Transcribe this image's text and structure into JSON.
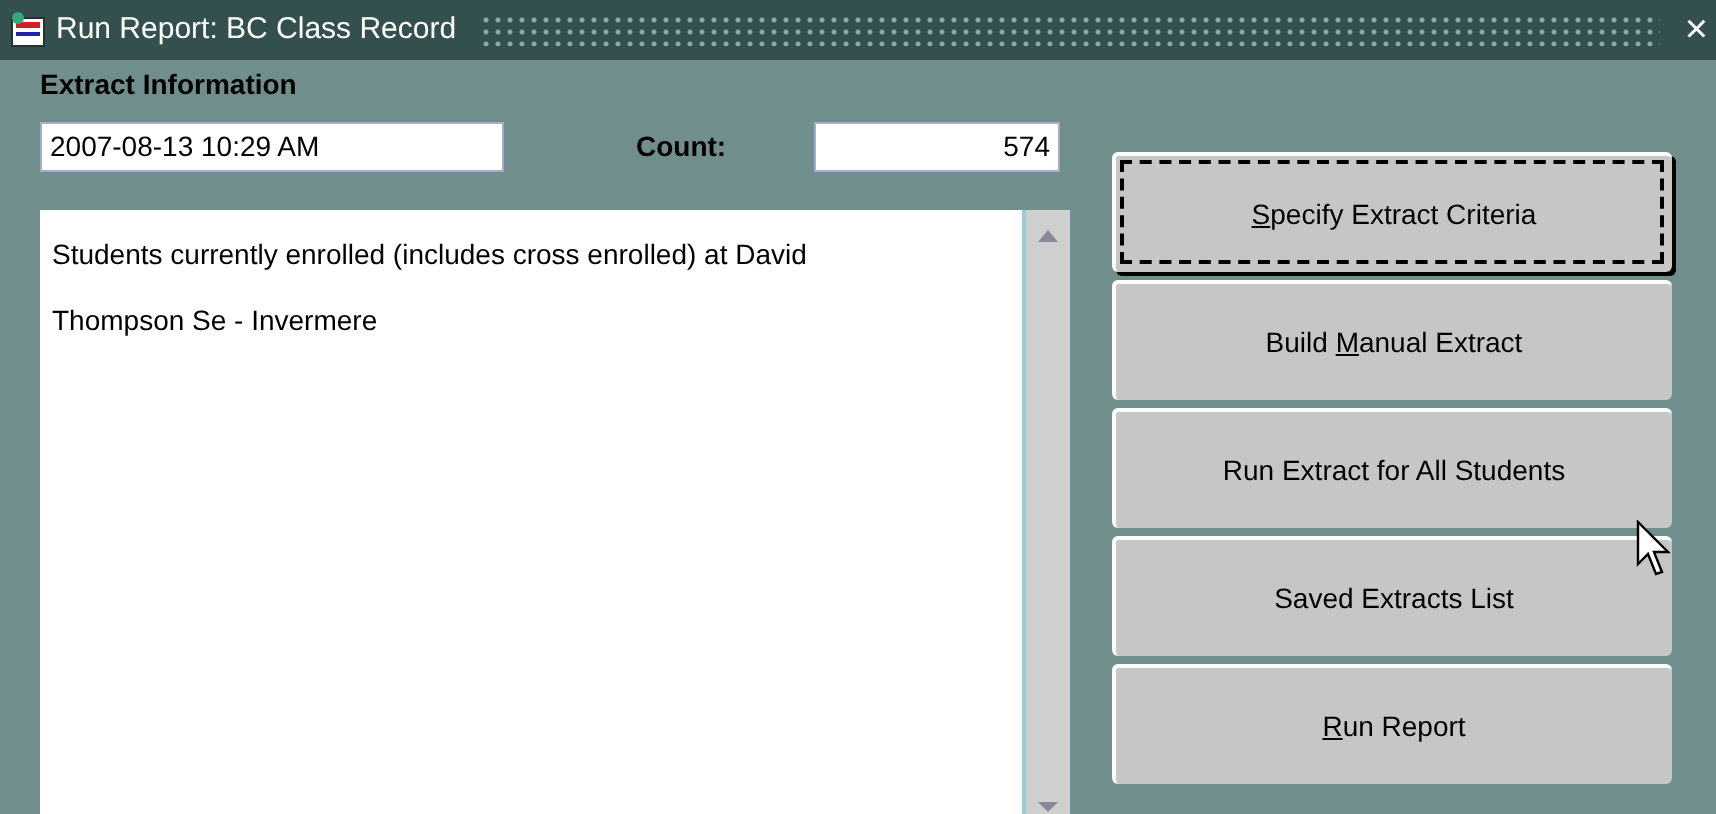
{
  "window": {
    "title": "Run Report: BC Class Record",
    "close": "×"
  },
  "section_title": "Extract Information",
  "date_field": {
    "value": "2007-08-13 10:29 AM"
  },
  "count": {
    "label": "Count:",
    "value": "574"
  },
  "description": {
    "value": "Students currently enrolled (includes cross enrolled) at David Thompson Se - Invermere"
  },
  "buttons": [
    {
      "key": "S",
      "post": "pecify Extract Criteria",
      "focused": true
    },
    {
      "pre": "Build ",
      "key": "M",
      "post": "anual Extract",
      "focused": false
    },
    {
      "pre": "Run Extract for All Students",
      "focused": false
    },
    {
      "pre": "Saved Extracts List",
      "focused": false
    },
    {
      "key": "R",
      "post": "un Report",
      "focused": false
    }
  ]
}
